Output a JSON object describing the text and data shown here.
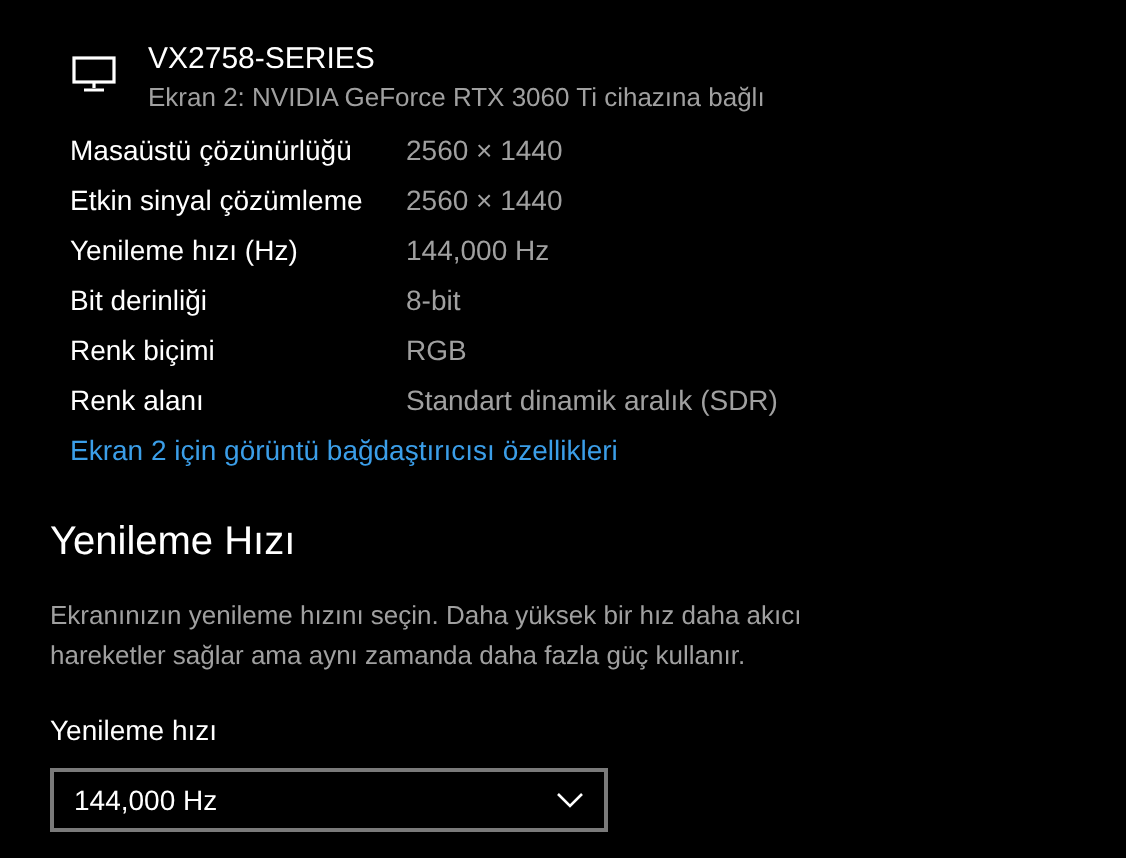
{
  "display": {
    "name": "VX2758-SERIES",
    "connection": "Ekran 2: NVIDIA GeForce RTX 3060 Ti cihazına bağlı"
  },
  "properties": [
    {
      "label": "Masaüstü çözünürlüğü",
      "value": "2560 × 1440"
    },
    {
      "label": "Etkin sinyal çözümleme",
      "value": "2560 × 1440"
    },
    {
      "label": "Yenileme hızı (Hz)",
      "value": "144,000 Hz"
    },
    {
      "label": "Bit derinliği",
      "value": "8-bit"
    },
    {
      "label": "Renk biçimi",
      "value": "RGB"
    },
    {
      "label": "Renk alanı",
      "value": "Standart dinamik aralık (SDR)"
    }
  ],
  "adapter_link": "Ekran 2 için görüntü bağdaştırıcısı özellikleri",
  "refresh_section": {
    "heading": "Yenileme Hızı",
    "description": "Ekranınızın yenileme hızını seçin. Daha yüksek bir hız daha akıcı hareketler sağlar ama aynı zamanda daha fazla güç kullanır.",
    "field_label": "Yenileme hızı",
    "dropdown_value": "144,000 Hz"
  }
}
